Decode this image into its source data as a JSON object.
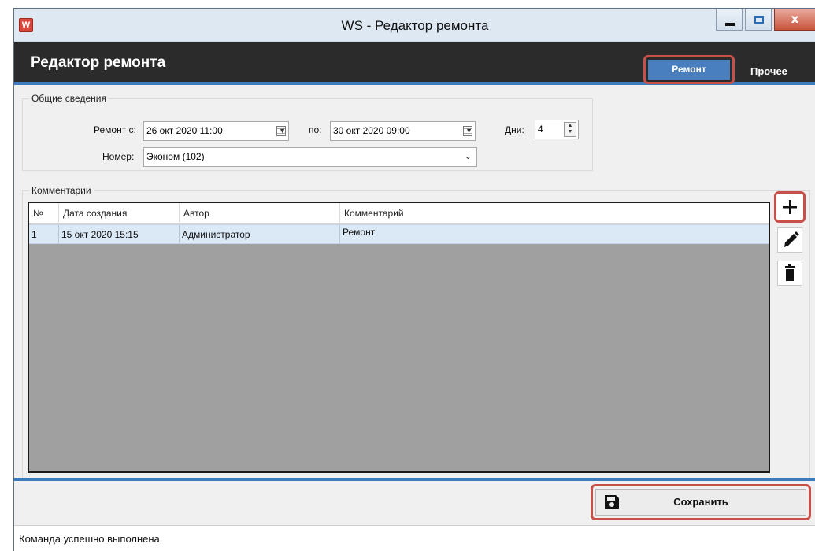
{
  "window": {
    "icon_text": "W",
    "title": "WS - Редактор ремонта",
    "close_glyph": "x"
  },
  "header": {
    "title": "Редактор ремонта",
    "tabs": [
      {
        "label": "Ремонт",
        "active": true
      },
      {
        "label": "Прочее",
        "active": false
      }
    ]
  },
  "general": {
    "legend": "Общие сведения",
    "repair_from_label": "Ремонт с:",
    "repair_from_value": "26 окт  2020  11:00",
    "to_label": "по:",
    "to_value": "30 окт  2020  09:00",
    "days_label": "Дни:",
    "days_value": "4",
    "room_label": "Номер:",
    "room_value": "Эконом (102)"
  },
  "comments": {
    "legend": "Комментарии",
    "columns": [
      "№",
      "Дата создания",
      "Автор",
      "Комментарий"
    ],
    "rows": [
      {
        "num": "1",
        "created": "15 окт 2020 15:15",
        "author": "Администратор",
        "comment": "Ремонт"
      }
    ]
  },
  "actions": {
    "add_icon": "plus-icon",
    "edit_icon": "pencil-icon",
    "delete_icon": "trash-icon"
  },
  "footer": {
    "save_label": "Сохранить",
    "status": "Команда успешно выполнена"
  },
  "colors": {
    "header_bg": "#2b2b2b",
    "accent": "#3e7bbd",
    "highlight": "#c9504a",
    "selected_row": "#dbe8f6"
  }
}
